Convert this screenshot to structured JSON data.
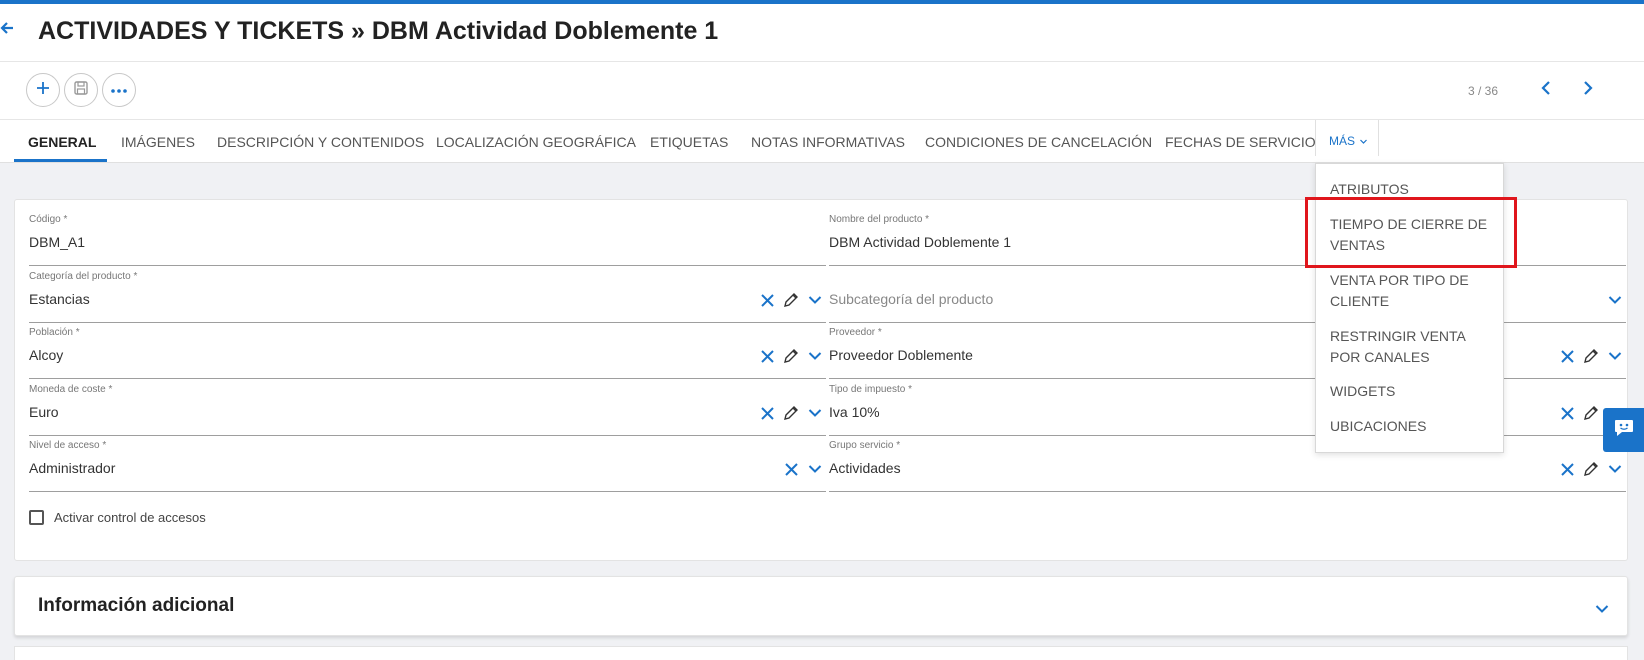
{
  "header": {
    "back_icon": "arrow-left-icon",
    "title": "ACTIVIDADES Y TICKETS » DBM Actividad Doblemente 1"
  },
  "toolbar": {
    "add_icon": "plus-icon",
    "save_icon": "save-icon",
    "more_icon": "ellipsis-icon",
    "pager": "3 / 36",
    "prev_icon": "chevron-left-icon",
    "next_icon": "chevron-right-icon"
  },
  "tabs": [
    {
      "label": "GENERAL"
    },
    {
      "label": "IMÁGENES"
    },
    {
      "label": "DESCRIPCIÓN Y CONTENIDOS"
    },
    {
      "label": "LOCALIZACIÓN GEOGRÁFICA"
    },
    {
      "label": "ETIQUETAS"
    },
    {
      "label": "NOTAS INFORMATIVAS"
    },
    {
      "label": "CONDICIONES DE CANCELACIÓN"
    },
    {
      "label": "FECHAS DE SERVICIO"
    }
  ],
  "more_tab": {
    "label": "MÁS"
  },
  "more_menu": [
    {
      "label": "ATRIBUTOS"
    },
    {
      "label": "TIEMPO DE CIERRE DE VENTAS"
    },
    {
      "label": "VENTA POR TIPO DE CLIENTE"
    },
    {
      "label": "RESTRINGIR VENTA POR CANALES"
    },
    {
      "label": "WIDGETS"
    },
    {
      "label": "UBICACIONES"
    }
  ],
  "form": {
    "codigo": {
      "label": "Código *",
      "value": "DBM_A1"
    },
    "nombre": {
      "label": "Nombre del producto *",
      "value": "DBM Actividad Doblemente 1"
    },
    "categoria": {
      "label": "Categoría del producto *",
      "value": "Estancias"
    },
    "subcategoria": {
      "label": "",
      "placeholder": "Subcategoría del producto"
    },
    "poblacion": {
      "label": "Población *",
      "value": "Alcoy"
    },
    "proveedor": {
      "label": "Proveedor *",
      "value": "Proveedor Doblemente"
    },
    "moneda": {
      "label": "Moneda de coste *",
      "value": "Euro"
    },
    "impuesto": {
      "label": "Tipo de impuesto *",
      "value": "Iva 10%"
    },
    "nivel": {
      "label": "Nivel de acceso *",
      "value": "Administrador"
    },
    "grupo": {
      "label": "Grupo servicio *",
      "value": "Actividades"
    },
    "control_accesos": {
      "label": "Activar control de accesos",
      "checked": false
    }
  },
  "sections": {
    "info_adicional": "Información adicional"
  },
  "colors": {
    "accent": "#1a73c9",
    "highlight": "#e0161c"
  }
}
